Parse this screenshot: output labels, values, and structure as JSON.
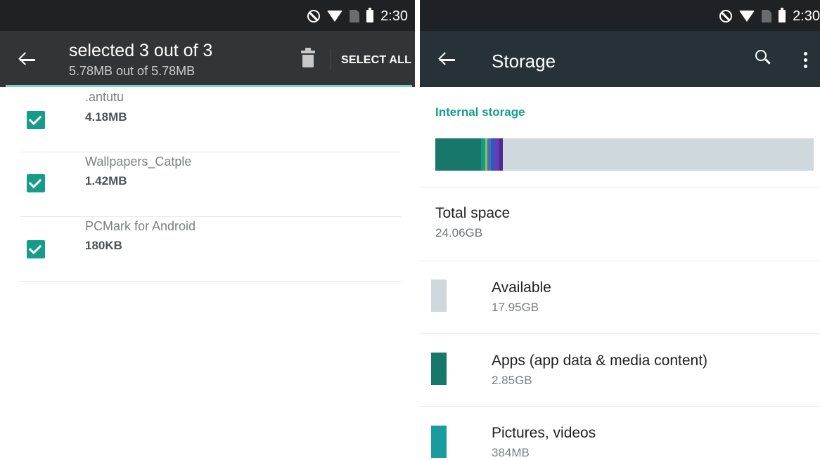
{
  "left_screen": {
    "status_bar": {
      "time": "2:30"
    },
    "app_bar": {
      "title": "selected 3 out of 3",
      "subtitle": "5.78MB out of 5.78MB",
      "select_all_label": "SELECT ALL"
    },
    "files": [
      {
        "name": ".antutu",
        "size": "4.18MB",
        "checked": true
      },
      {
        "name": "Wallpapers_Catple",
        "size": "1.42MB",
        "checked": true
      },
      {
        "name": "PCMark for Android",
        "size": "180KB",
        "checked": true
      }
    ]
  },
  "right_screen": {
    "status_bar": {
      "time": "2:30"
    },
    "app_bar": {
      "title": "Storage"
    },
    "section_label": "Internal storage",
    "storage_bar": {
      "segments": [
        {
          "color": "#17786a",
          "percent": 12
        },
        {
          "color": "#159a8a",
          "percent": 1.2
        },
        {
          "color": "#8bc34a",
          "percent": 0.6
        },
        {
          "color": "#4a6dbd",
          "percent": 0.9
        },
        {
          "color": "#2f5bb7",
          "percent": 1.1
        },
        {
          "color": "#673ab7",
          "percent": 1.2
        },
        {
          "color": "#4a2c8f",
          "percent": 0.9
        }
      ],
      "remainder_color": "#cfd8dc"
    },
    "total": {
      "label": "Total space",
      "value": "24.06GB"
    },
    "categories": [
      {
        "label": "Available",
        "value": "17.95GB",
        "color": "#cfd8dc"
      },
      {
        "label": "Apps (app data & media content)",
        "value": "2.85GB",
        "color": "#17786a"
      },
      {
        "label": "Pictures, videos",
        "value": "384MB",
        "color": "#1a9ba0"
      }
    ]
  }
}
